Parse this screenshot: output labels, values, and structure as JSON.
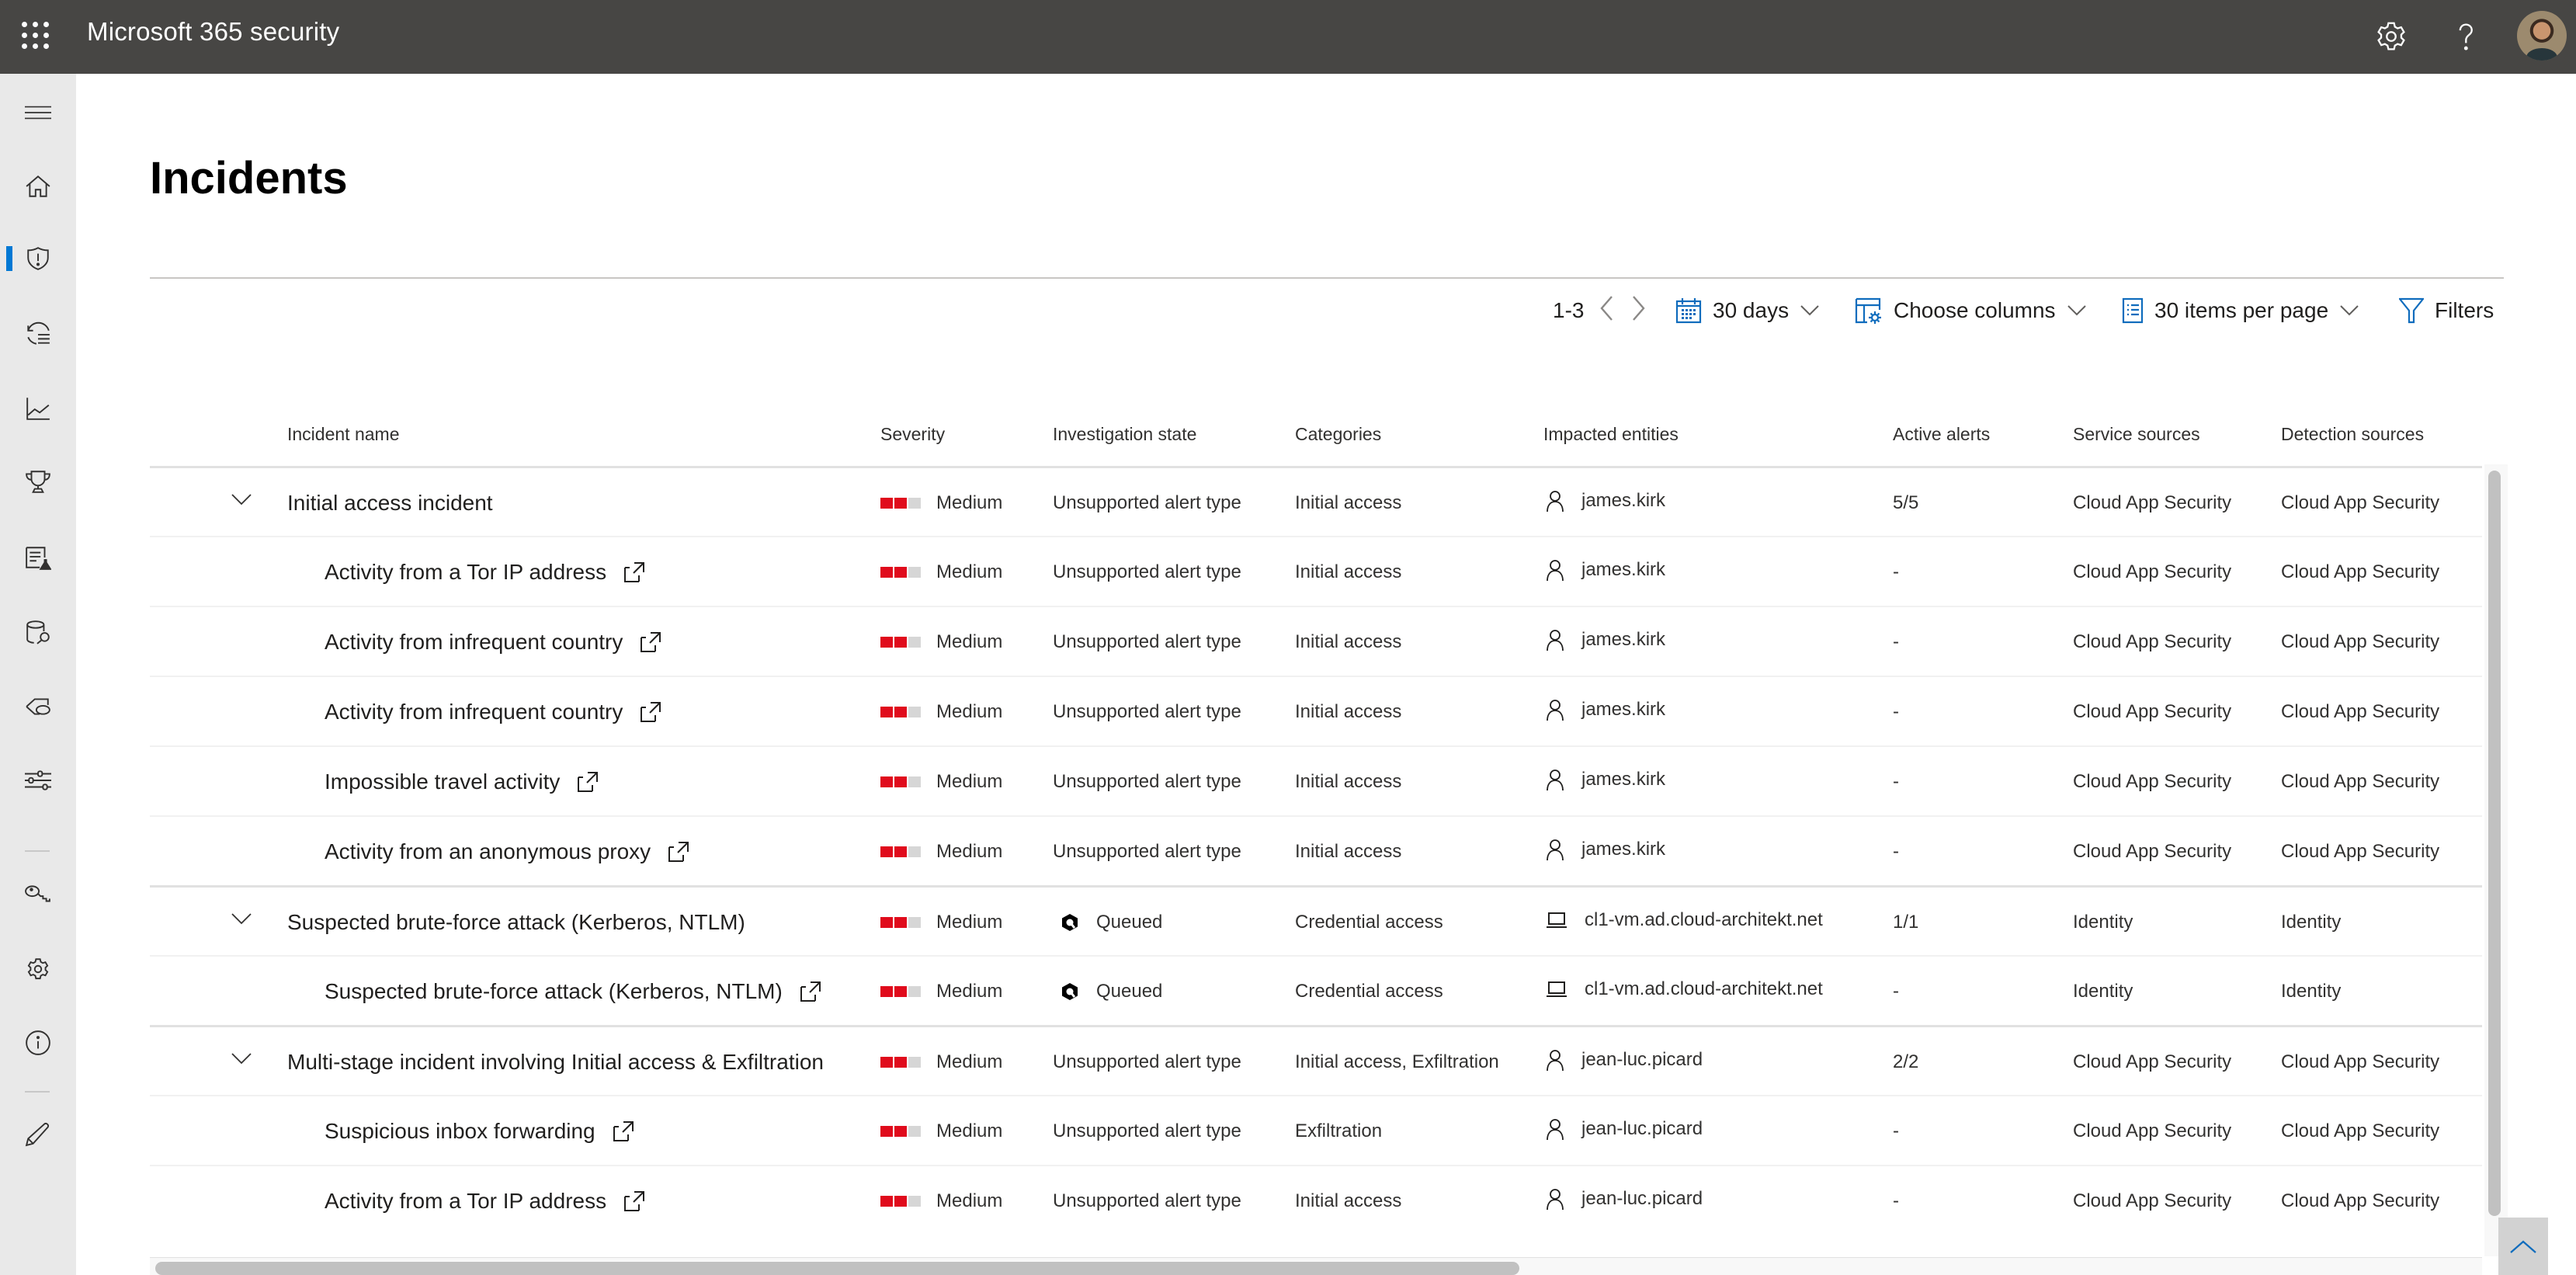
{
  "app": {
    "title": "Microsoft 365 security",
    "icons": {
      "launcher": "waffle-icon",
      "settings": "gear-icon",
      "help": "question-icon",
      "profile": "avatar"
    }
  },
  "sidebar": {
    "items": [
      {
        "id": "menu",
        "icon": "hamburger-icon",
        "active": false
      },
      {
        "id": "home",
        "icon": "home-icon",
        "active": false
      },
      {
        "id": "incidents",
        "icon": "shield-alert-icon",
        "active": true
      },
      {
        "id": "action-center",
        "icon": "history-list-icon",
        "active": false
      },
      {
        "id": "reports",
        "icon": "line-chart-icon",
        "active": false
      },
      {
        "id": "secure-score",
        "icon": "trophy-icon",
        "active": false
      },
      {
        "id": "hunting",
        "icon": "document-flask-icon",
        "active": false
      },
      {
        "id": "classification",
        "icon": "database-search-icon",
        "active": false
      },
      {
        "id": "labels",
        "icon": "tag-icon",
        "active": false
      },
      {
        "id": "policies",
        "icon": "sliders-icon",
        "active": false
      },
      {
        "id": "permissions",
        "icon": "key-icon",
        "active": false
      },
      {
        "id": "settings",
        "icon": "gear-icon",
        "active": false
      },
      {
        "id": "more-resources",
        "icon": "info-icon",
        "active": false
      },
      {
        "id": "customize",
        "icon": "pencil-icon",
        "active": false
      }
    ],
    "accent": "#0078d4"
  },
  "page": {
    "title": "Incidents"
  },
  "toolbar": {
    "range": "1-3",
    "time_filter": "30 days",
    "choose_columns": "Choose columns",
    "items_per_page": "30 items per page",
    "filters": "Filters",
    "icon_color": "#0f6cbd"
  },
  "table": {
    "columns": [
      "Incident name",
      "Severity",
      "Investigation state",
      "Categories",
      "Impacted entities",
      "Active alerts",
      "Service sources",
      "Detection sources"
    ],
    "severity_colors": {
      "filled": "#e00b1c",
      "empty": "#d6d6d6"
    },
    "rows": [
      {
        "level": "incident",
        "name": "Initial access incident",
        "severity": "Medium",
        "severity_level": 2,
        "investigation_state": "Unsupported alert type",
        "state_icon": "",
        "categories": "Initial access",
        "entity_type": "user",
        "entity": "james.kirk",
        "active_alerts": "5/5",
        "service_sources": "Cloud App Security",
        "detection_sources": "Cloud App Security"
      },
      {
        "level": "alert",
        "name": "Activity from a Tor IP address",
        "severity": "Medium",
        "severity_level": 2,
        "investigation_state": "Unsupported alert type",
        "state_icon": "",
        "categories": "Initial access",
        "entity_type": "user",
        "entity": "james.kirk",
        "active_alerts": "-",
        "service_sources": "Cloud App Security",
        "detection_sources": "Cloud App Security"
      },
      {
        "level": "alert",
        "name": "Activity from infrequent country",
        "severity": "Medium",
        "severity_level": 2,
        "investigation_state": "Unsupported alert type",
        "state_icon": "",
        "categories": "Initial access",
        "entity_type": "user",
        "entity": "james.kirk",
        "active_alerts": "-",
        "service_sources": "Cloud App Security",
        "detection_sources": "Cloud App Security"
      },
      {
        "level": "alert",
        "name": "Activity from infrequent country",
        "severity": "Medium",
        "severity_level": 2,
        "investigation_state": "Unsupported alert type",
        "state_icon": "",
        "categories": "Initial access",
        "entity_type": "user",
        "entity": "james.kirk",
        "active_alerts": "-",
        "service_sources": "Cloud App Security",
        "detection_sources": "Cloud App Security"
      },
      {
        "level": "alert",
        "name": "Impossible travel activity",
        "severity": "Medium",
        "severity_level": 2,
        "investigation_state": "Unsupported alert type",
        "state_icon": "",
        "categories": "Initial access",
        "entity_type": "user",
        "entity": "james.kirk",
        "active_alerts": "-",
        "service_sources": "Cloud App Security",
        "detection_sources": "Cloud App Security"
      },
      {
        "level": "alert",
        "name": "Activity from an anonymous proxy",
        "severity": "Medium",
        "severity_level": 2,
        "investigation_state": "Unsupported alert type",
        "state_icon": "",
        "categories": "Initial access",
        "entity_type": "user",
        "entity": "james.kirk",
        "active_alerts": "-",
        "service_sources": "Cloud App Security",
        "detection_sources": "Cloud App Security"
      },
      {
        "level": "incident",
        "name": "Suspected brute-force attack (Kerberos, NTLM)",
        "severity": "Medium",
        "severity_level": 2,
        "investigation_state": "Queued",
        "state_icon": "queued-icon",
        "categories": "Credential access",
        "entity_type": "device",
        "entity": "cl1-vm.ad.cloud-architekt.net",
        "active_alerts": "1/1",
        "service_sources": "Identity",
        "detection_sources": "Identity"
      },
      {
        "level": "alert",
        "name": "Suspected brute-force attack (Kerberos, NTLM)",
        "severity": "Medium",
        "severity_level": 2,
        "investigation_state": "Queued",
        "state_icon": "queued-icon",
        "categories": "Credential access",
        "entity_type": "device",
        "entity": "cl1-vm.ad.cloud-architekt.net",
        "active_alerts": "-",
        "service_sources": "Identity",
        "detection_sources": "Identity"
      },
      {
        "level": "incident",
        "name": "Multi-stage incident involving Initial access & Exfiltration",
        "severity": "Medium",
        "severity_level": 2,
        "investigation_state": "Unsupported alert type",
        "state_icon": "",
        "categories": "Initial access, Exfiltration",
        "entity_type": "user",
        "entity": "jean-luc.picard",
        "active_alerts": "2/2",
        "service_sources": "Cloud App Security",
        "detection_sources": "Cloud App Security"
      },
      {
        "level": "alert",
        "name": "Suspicious inbox forwarding",
        "severity": "Medium",
        "severity_level": 2,
        "investigation_state": "Unsupported alert type",
        "state_icon": "",
        "categories": "Exfiltration",
        "entity_type": "user",
        "entity": "jean-luc.picard",
        "active_alerts": "-",
        "service_sources": "Cloud App Security",
        "detection_sources": "Cloud App Security"
      },
      {
        "level": "alert",
        "name": "Activity from a Tor IP address",
        "severity": "Medium",
        "severity_level": 2,
        "investigation_state": "Unsupported alert type",
        "state_icon": "",
        "categories": "Initial access",
        "entity_type": "user",
        "entity": "jean-luc.picard",
        "active_alerts": "-",
        "service_sources": "Cloud App Security",
        "detection_sources": "Cloud App Security"
      }
    ]
  }
}
